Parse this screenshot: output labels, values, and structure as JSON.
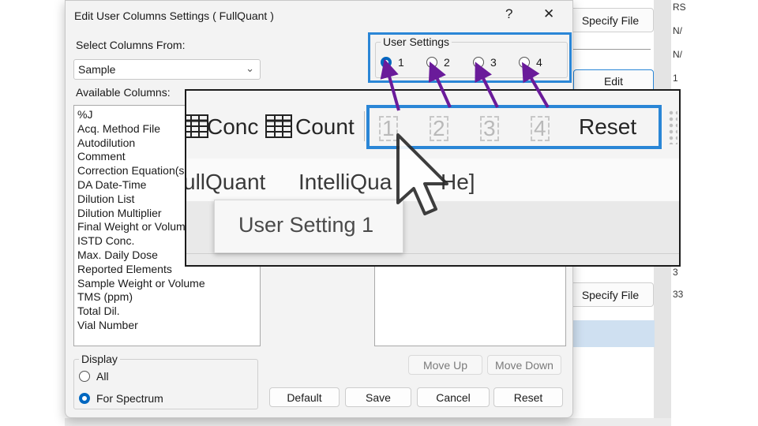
{
  "background": {
    "specify_file_top": "Specify File",
    "specify_file_bottom": "Specify File",
    "edit_button": "Edit",
    "right_cells": [
      "RS",
      "N/",
      "N/",
      "1",
      "3",
      "33"
    ]
  },
  "dialog": {
    "title": "Edit User Columns Settings ( FullQuant )",
    "help_icon": "?",
    "close_icon": "✕",
    "select_from_label": "Select Columns From:",
    "select_from_value": "Sample",
    "available_label": "Available Columns:",
    "available_columns": [
      "%J",
      "Acq. Method File",
      "Autodilution",
      "Comment",
      "Correction Equation(s",
      "DA Date-Time",
      "Dilution List",
      "Dilution Multiplier",
      "Final Weight or Volum",
      "ISTD Conc.",
      "Max. Daily Dose",
      "Reported Elements",
      "Sample Weight or Volume",
      "TMS (ppm)",
      "Total Dil.",
      "Vial Number"
    ],
    "user_settings": {
      "legend": "User Settings",
      "options": [
        "1",
        "2",
        "3",
        "4"
      ],
      "selected": "1"
    },
    "display": {
      "legend": "Display",
      "options": [
        "All",
        "For Spectrum"
      ],
      "selected": "For Spectrum"
    },
    "buttons": {
      "move_up": "Move Up",
      "move_down": "Move Down",
      "default": "Default",
      "save": "Save",
      "cancel": "Cancel",
      "reset": "Reset"
    }
  },
  "zoom": {
    "conc_label": "Conc",
    "count_label": "Count",
    "setting_buttons": [
      "1",
      "2",
      "3",
      "4"
    ],
    "reset_label": "Reset",
    "tab_partial_1": "ullQuant",
    "tab_partial_2": "IntelliQua",
    "tab_partial_3": "He]",
    "tooltip": "User Setting 1"
  },
  "colors": {
    "accent": "#0067c0",
    "highlight": "#2a86d6",
    "arrow": "#6a1b9a"
  }
}
